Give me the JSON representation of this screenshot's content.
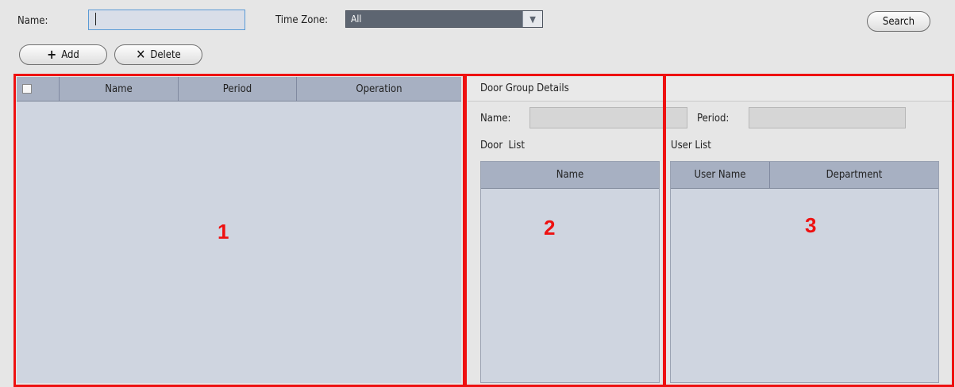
{
  "filter": {
    "name_label": "Name:",
    "time_zone_label": "Time Zone:",
    "time_zone_value": "All",
    "search_label": "Search"
  },
  "toolbar": {
    "add_label": "Add",
    "delete_label": "Delete",
    "add_icon": "plus-icon",
    "delete_icon": "x-icon"
  },
  "group_table": {
    "columns": [
      "Name",
      "Period",
      "Operation"
    ]
  },
  "details": {
    "title": "Door Group Details",
    "name_label": "Name:",
    "period_label": "Period:",
    "door_list_label": "Door  List",
    "user_list_label": "User List",
    "door_columns": [
      "Name"
    ],
    "user_columns": [
      "User Name",
      "Department"
    ]
  },
  "annotations": {
    "box1": "1",
    "box2": "2",
    "box3": "3",
    "color": "#ee1111"
  }
}
